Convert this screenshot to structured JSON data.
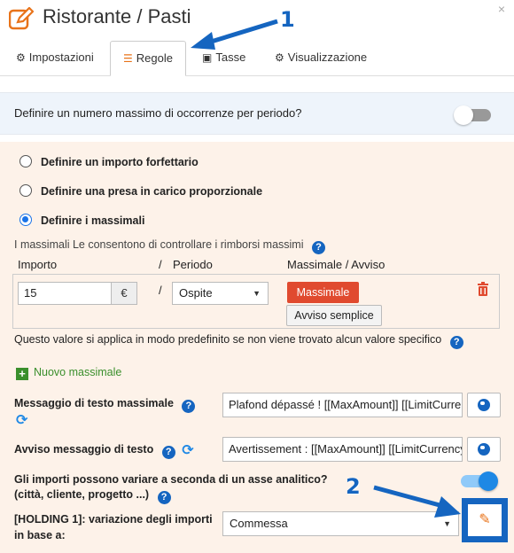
{
  "window": {
    "title": "Ristorante / Pasti",
    "close_glyph": "×"
  },
  "tabs": [
    {
      "label": "Impostazioni",
      "icon": "gear-icon",
      "glyph": "⚙"
    },
    {
      "label": "Regole",
      "icon": "sliders-icon",
      "glyph": "☰"
    },
    {
      "label": "Tasse",
      "icon": "money-icon",
      "glyph": "▣"
    },
    {
      "label": "Visualizzazione",
      "icon": "cogs-icon",
      "glyph": "⚙"
    }
  ],
  "active_tab": "Regole",
  "banner": {
    "label": "Definire un numero massimo di occorrenze per periodo?",
    "toggle_on": false
  },
  "options": [
    {
      "label": "Definire un importo forfettario",
      "checked": false
    },
    {
      "label": "Definire una presa in carico proporzionale",
      "checked": false
    },
    {
      "label": "Definire i massimali",
      "checked": true
    }
  ],
  "limits": {
    "intro": "I massimali Le consentono di controllare i rimborsi massimi",
    "columns": {
      "amount": "Importo",
      "separator": "/",
      "period": "Periodo",
      "limit": "Massimale / Avviso"
    },
    "row": {
      "amount": "15",
      "currency": "€",
      "separator": "/",
      "period": "Ospite",
      "limit_button": "Massimale",
      "warning_button": "Avviso semplice"
    },
    "default_note": "Questo valore si applica in modo predefinito se non viene trovato alcun valore specifico",
    "add_label": "Nuovo massimale"
  },
  "messages": {
    "limit_label": "Messaggio di testo massimale",
    "limit_value": "Plafond dépassé ! [[MaxAmount]] [[LimitCurrency]]",
    "warning_label": "Avviso messaggio di testo",
    "warning_value": "Avertissement : [[MaxAmount]] [[LimitCurrency]]"
  },
  "analytic": {
    "question_line1": "Gli importi possono variare a seconda di un asse analitico?",
    "question_line2": "(città, cliente, progetto ...)",
    "toggle_on": true,
    "holding_line1": "[HOLDING 1]: variazione degli importi",
    "holding_line2": "in base a:",
    "holding_value": "Commessa"
  },
  "annotations": {
    "marker_1": "1",
    "marker_2": "2"
  },
  "colors": {
    "accent_blue": "#1565c0",
    "danger_red": "#e04a2f",
    "panel_bg": "#fdf2e9",
    "banner_bg": "#eef4fb",
    "add_green": "#3a8f2c",
    "edit_orange": "#e8731a"
  }
}
